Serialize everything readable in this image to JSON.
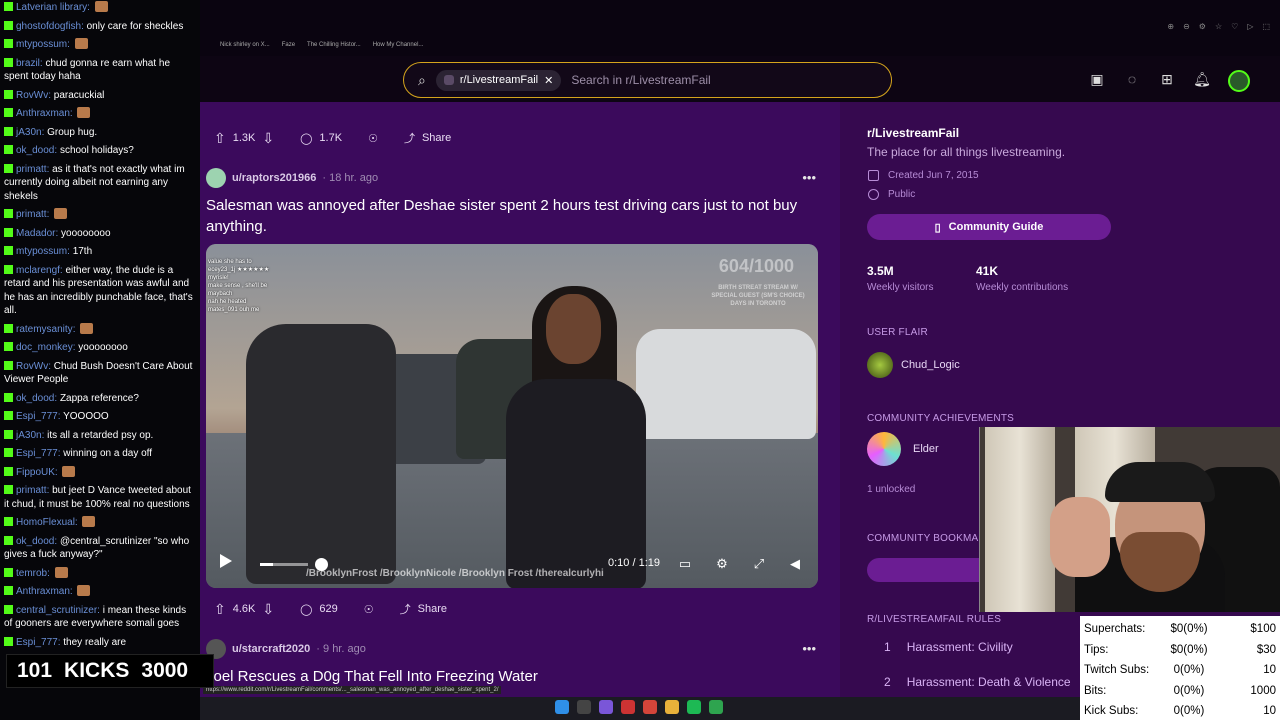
{
  "chat": {
    "messages": [
      {
        "user": "Latverian library",
        "text": ""
      },
      {
        "user": "ghostofdogfish",
        "text": "only care for sheckles"
      },
      {
        "user": "mtypossum",
        "text": ""
      },
      {
        "user": "brazil",
        "text": "chud gonna re earn what he spent today haha"
      },
      {
        "user": "RovWv",
        "text": "paracuckial"
      },
      {
        "user": "Anthraxman",
        "text": ""
      },
      {
        "user": "jA30n",
        "text": "Group hug."
      },
      {
        "user": "ok_dood",
        "text": "school holidays?"
      },
      {
        "user": "primatt",
        "text": "as it that's not exactly what im currently doing albeit not earning any shekels"
      },
      {
        "user": "primatt",
        "text": ""
      },
      {
        "user": "Madador",
        "text": "yoooooooo"
      },
      {
        "user": "mtypossum",
        "text": "17th"
      },
      {
        "user": "mclarengf",
        "text": "either way, the dude is a retard and his presentation was awful and he has an incredibly punchable face, that's all."
      },
      {
        "user": "ratemysanity",
        "text": ""
      },
      {
        "user": "doc_monkey",
        "text": "yoooooooo"
      },
      {
        "user": "RovWv",
        "text": "Chud Bush Doesn't Care About Viewer People"
      },
      {
        "user": "ok_dood",
        "text": "Zappa reference?"
      },
      {
        "user": "Espi_777",
        "text": "YOOOOO"
      },
      {
        "user": "jA30n",
        "text": "its all a retarded psy op."
      },
      {
        "user": "Espi_777",
        "text": "winning on a day off"
      },
      {
        "user": "FippoUK",
        "text": ""
      },
      {
        "user": "primatt",
        "text": "but jeet D Vance tweeted about it chud, it must be 100% real no questions"
      },
      {
        "user": "HomoFlexual",
        "text": ""
      },
      {
        "user": "ok_dood",
        "text": "@central_scrutinizer \"so who gives a fuck anyway?\""
      },
      {
        "user": "temrob",
        "text": ""
      },
      {
        "user": "Anthraxman",
        "text": ""
      },
      {
        "user": "central_scrutinizer",
        "text": "i mean these kinds of gooners are everywhere somali goes"
      },
      {
        "user": "Espi_777",
        "text": "they really are"
      }
    ],
    "kicks_count": "101",
    "kicks_label": "KICKS",
    "kicks_goal": "3000"
  },
  "browser": {
    "bookmarks": [
      "Nick shirley on X...",
      "Faze",
      "The Chilling Histor...",
      "How My Channel..."
    ],
    "status_url": "https://www.reddit.com/r/LivestreamFail/comments/..._salesman_was_annoyed_after_deshae_sister_spent_2/"
  },
  "search": {
    "subreddit": "r/LivestreamFail",
    "placeholder": "Search in r/LivestreamFail"
  },
  "post1": {
    "upvotes": "1.3K",
    "comments": "1.7K",
    "share": "Share"
  },
  "post2": {
    "author": "u/raptors201966",
    "time": "18 hr. ago",
    "title": "Salesman was annoyed after Deshae sister spent 2 hours test driving cars just to not buy anything.",
    "upvotes": "4.6K",
    "comments": "629",
    "share": "Share",
    "video": {
      "current": "0:10",
      "duration": "1:19",
      "progress": 0.127,
      "counter": "604/1000",
      "socials": "/BrooklynFrost  /BrooklynNicole  /Brooklyn Frost  /therealcurlyhi",
      "info": "BIRTH STREAT STREAM W/ SPECIAL GUEST (SM'S CHOICE) DAYS IN TORONTO"
    }
  },
  "post3": {
    "author": "u/starcraft2020",
    "time": "9 hr. ago",
    "title": "Joel Rescues a D0g That Fell Into Freezing Water"
  },
  "sidebar": {
    "name": "r/LivestreamFail",
    "description": "The place for all things livestreaming.",
    "created": "Created Jun 7, 2015",
    "visibility": "Public",
    "guide_button": "Community Guide",
    "visitors_value": "3.5M",
    "visitors_label": "Weekly visitors",
    "contrib_value": "41K",
    "contrib_label": "Weekly contributions",
    "flair_header": "USER FLAIR",
    "flair": "Chud_Logic",
    "achievements_header": "COMMUNITY ACHIEVEMENTS",
    "achievement": "Elder",
    "unlocked": "1 unlocked",
    "bookmarks_header": "COMMUNITY BOOKMA",
    "rules_header": "R/LIVESTREAMFAIL RULES",
    "rules": [
      {
        "n": "1",
        "text": "Harassment: Civility"
      },
      {
        "n": "2",
        "text": "Harassment: Death & Violence"
      }
    ]
  },
  "stream_stats": [
    {
      "label": "Superchats:",
      "value": "$0(0%)",
      "goal": "$100"
    },
    {
      "label": "Tips:",
      "value": "$0(0%)",
      "goal": "$30"
    },
    {
      "label": "Twitch Subs:",
      "value": "0(0%)",
      "goal": "10"
    },
    {
      "label": "Bits:",
      "value": "0(0%)",
      "goal": "1000"
    },
    {
      "label": "Kick Subs:",
      "value": "0(0%)",
      "goal": "10"
    }
  ],
  "colors": {
    "feed_bg": "#3b0a5c",
    "sidebar_bg": "#36094f",
    "accent_button": "#6b1d93",
    "kick_green": "#53fc18",
    "search_border": "#d4a41c"
  }
}
